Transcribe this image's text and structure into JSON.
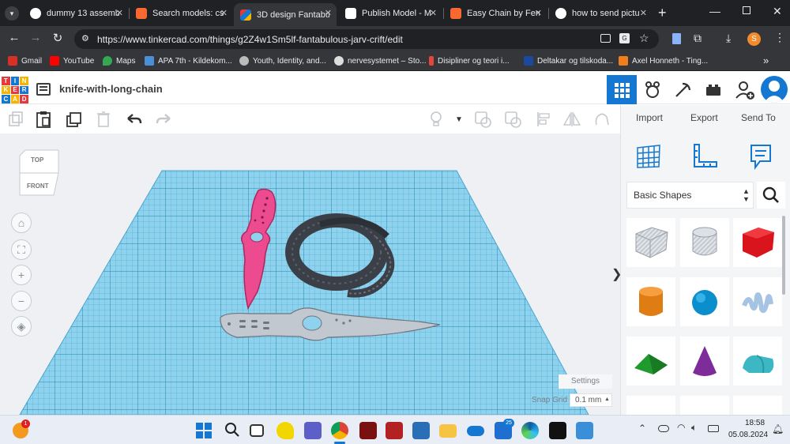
{
  "browser": {
    "tabs": [
      {
        "title": "dummy 13 assemb",
        "icon": "google-icon"
      },
      {
        "title": "Search models: cs",
        "icon": "printables-icon"
      },
      {
        "title": "3D design Fantabu",
        "icon": "tinkercad-icon",
        "active": true
      },
      {
        "title": "Publish Model - M",
        "icon": "makerworld-icon"
      },
      {
        "title": "Easy Chain by Fern",
        "icon": "printables-icon"
      },
      {
        "title": "how to send pictu",
        "icon": "google-icon"
      }
    ],
    "new_tab": "+",
    "url": "https://www.tinkercad.com/things/g2Z4w1Sm5lf-fantabulous-jarv-crift/edit",
    "profile_initial": "S"
  },
  "bookmarks": [
    {
      "label": "Gmail",
      "color": "#d93025"
    },
    {
      "label": "YouTube",
      "color": "#ff0000"
    },
    {
      "label": "Maps",
      "color": "#34a853"
    },
    {
      "label": "APA 7th - Kildekom...",
      "color": "#4a90d9"
    },
    {
      "label": "Youth, Identity, and...",
      "color": "#bbbbbb"
    },
    {
      "label": "nervesystemet – Sto...",
      "color": "#dddddd"
    },
    {
      "label": "Disipliner og teori i...",
      "color": "#e8453c"
    },
    {
      "label": "Deltakar og tilskoda...",
      "color": "#1a4aa0"
    },
    {
      "label": "Axel Honneth - Ting...",
      "color": "#f07e1b"
    }
  ],
  "app": {
    "logo_letters": [
      "TIN",
      "KER",
      "CAD"
    ],
    "design_title": "knife-with-long-chain",
    "import_label": "Import",
    "export_label": "Export",
    "send_to_label": "Send To",
    "shape_category": "Basic Shapes",
    "settings_label": "Settings",
    "snap_grid_label": "Snap Grid",
    "snap_grid_value": "0.1 mm",
    "view_cube_top": "TOP",
    "view_cube_front": "FRONT",
    "accent_color": "#1477d1"
  },
  "taskbar": {
    "time": "18:58",
    "date": "05.08.2024",
    "mail_badge": "25",
    "notif_badge": "1"
  }
}
